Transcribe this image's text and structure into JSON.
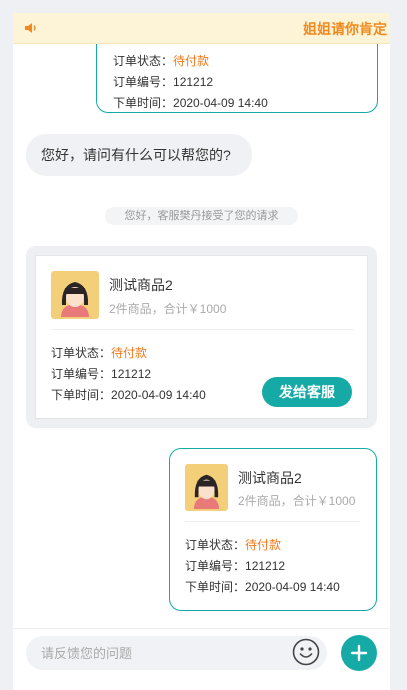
{
  "notice": {
    "text": "姐姐请你肯定"
  },
  "top_order": {
    "status_label": "订单状态：",
    "status_value": "待付款",
    "number_label": "订单编号：",
    "number_value": "121212",
    "time_label": "下单时间：",
    "time_value": "2020-04-09 14:40"
  },
  "greeting": "您好，请问有什么可以帮您的?",
  "system_message": "您好，客服樊丹接受了您的请求",
  "product_card": {
    "name": "测试商品2",
    "summary": "2件商品，合计￥1000",
    "status_label": "订单状态：",
    "status_value": "待付款",
    "number_label": "订单编号：",
    "number_value": "121212",
    "time_label": "下单时间：",
    "time_value": "2020-04-09 14:40",
    "send_button": "发给客服"
  },
  "sent_order": {
    "name": "测试商品2",
    "summary": "2件商品，合计￥1000",
    "status_label": "订单状态：",
    "status_value": "待付款",
    "number_label": "订单编号：",
    "number_value": "121212",
    "time_label": "下单时间：",
    "time_value": "2020-04-09 14:40"
  },
  "input": {
    "placeholder": "请反馈您的问题"
  },
  "icons": {
    "speaker": "speaker-icon",
    "emoji": "emoji-icon",
    "plus": "plus-icon"
  },
  "colors": {
    "accent": "#16aaa7",
    "pending": "#ef7a1e",
    "notice_bg": "#fdf3d6",
    "notice_text": "#ef8a1f"
  }
}
